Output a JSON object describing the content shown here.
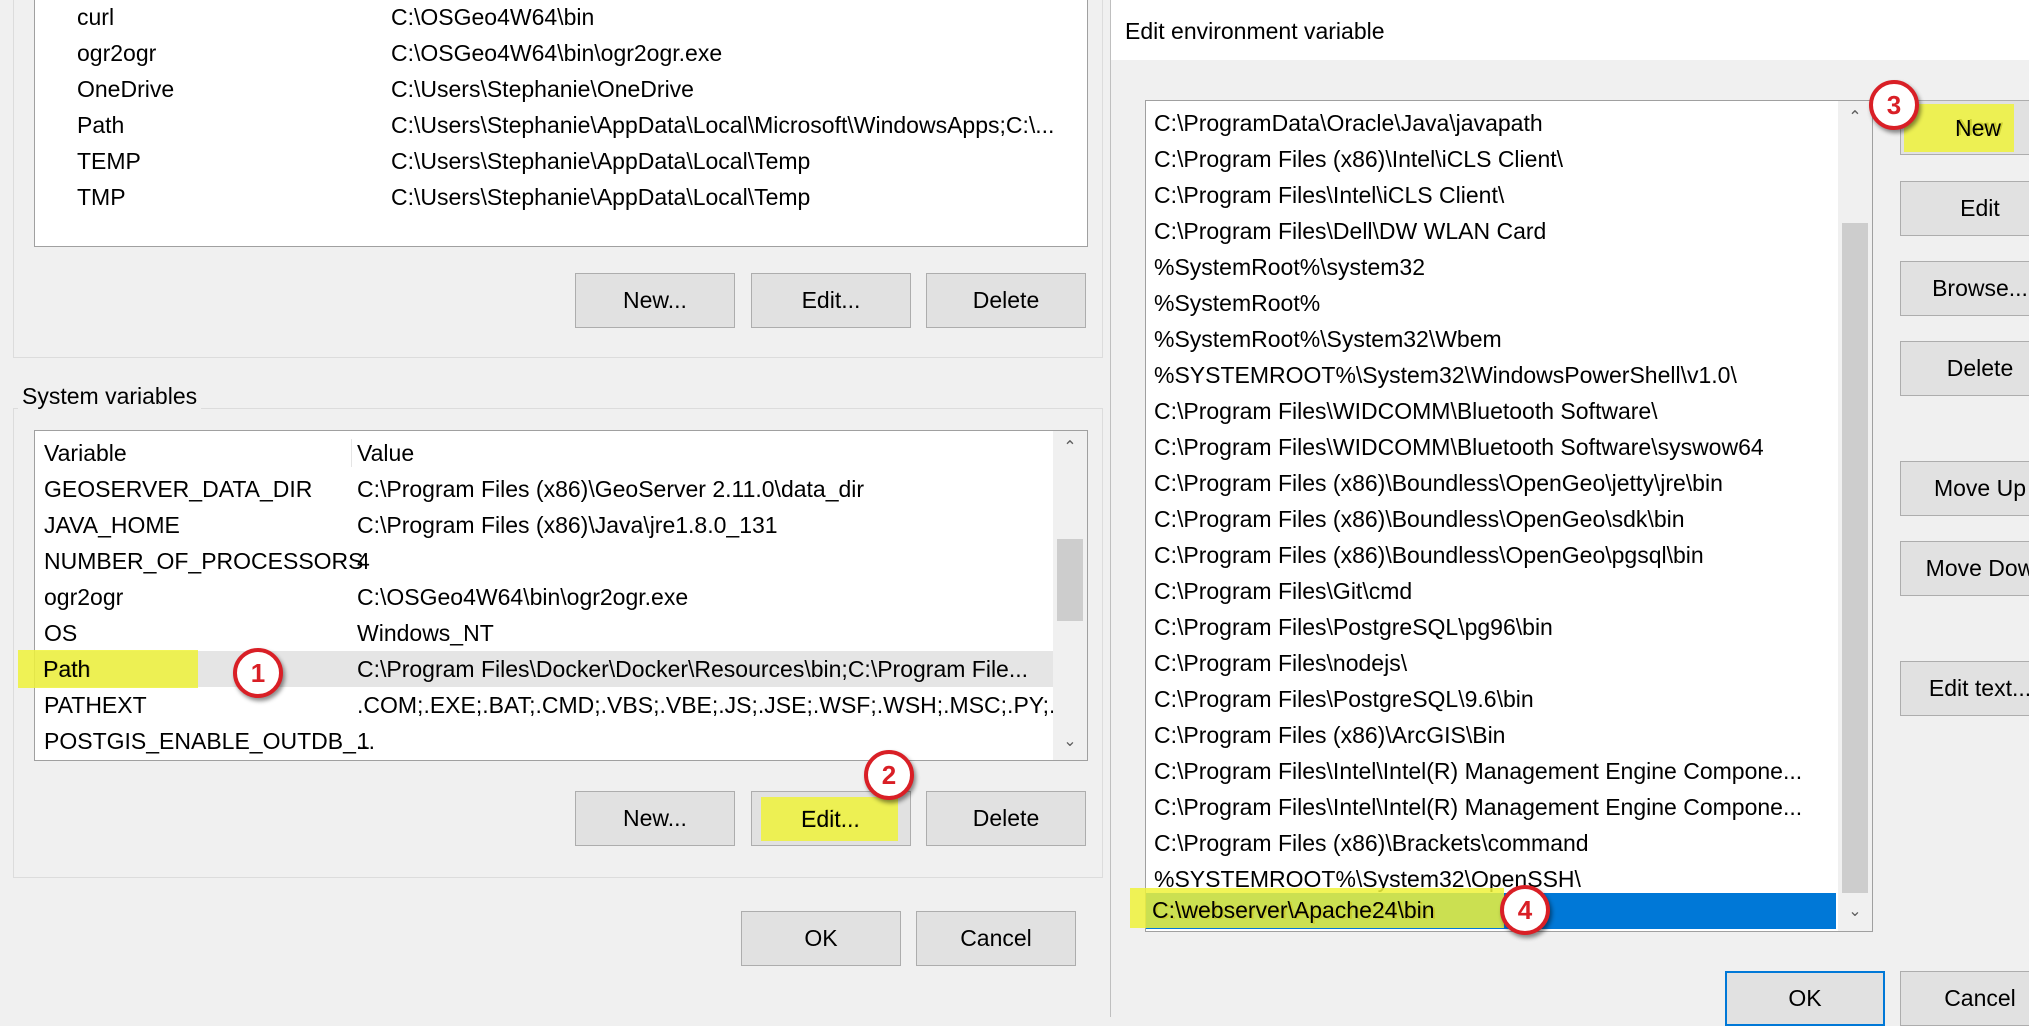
{
  "user_vars": {
    "rows": [
      {
        "name": "curl",
        "value": "C:\\OSGeo4W64\\bin"
      },
      {
        "name": "ogr2ogr",
        "value": "C:\\OSGeo4W64\\bin\\ogr2ogr.exe"
      },
      {
        "name": "OneDrive",
        "value": "C:\\Users\\Stephanie\\OneDrive"
      },
      {
        "name": "Path",
        "value": "C:\\Users\\Stephanie\\AppData\\Local\\Microsoft\\WindowsApps;C:\\..."
      },
      {
        "name": "TEMP",
        "value": "C:\\Users\\Stephanie\\AppData\\Local\\Temp"
      },
      {
        "name": "TMP",
        "value": "C:\\Users\\Stephanie\\AppData\\Local\\Temp"
      }
    ],
    "buttons": {
      "new": "New...",
      "edit": "Edit...",
      "delete": "Delete"
    }
  },
  "system_vars": {
    "label": "System variables",
    "headers": {
      "variable": "Variable",
      "value": "Value"
    },
    "rows": [
      {
        "name": "GEOSERVER_DATA_DIR",
        "value": "C:\\Program Files (x86)\\GeoServer 2.11.0\\data_dir"
      },
      {
        "name": "JAVA_HOME",
        "value": "C:\\Program Files (x86)\\Java\\jre1.8.0_131"
      },
      {
        "name": "NUMBER_OF_PROCESSORS",
        "value": "4"
      },
      {
        "name": "ogr2ogr",
        "value": "C:\\OSGeo4W64\\bin\\ogr2ogr.exe"
      },
      {
        "name": "OS",
        "value": "Windows_NT"
      },
      {
        "name": "Path",
        "value": "C:\\Program Files\\Docker\\Docker\\Resources\\bin;C:\\Program File..."
      },
      {
        "name": "PATHEXT",
        "value": ".COM;.EXE;.BAT;.CMD;.VBS;.VBE;.JS;.JSE;.WSF;.WSH;.MSC;.PY;.PYW"
      },
      {
        "name": "POSTGIS_ENABLE_OUTDB_...",
        "value": "1"
      }
    ],
    "buttons": {
      "new": "New...",
      "edit": "Edit...",
      "delete": "Delete"
    }
  },
  "dialog_buttons": {
    "ok": "OK",
    "cancel": "Cancel"
  },
  "edit_dialog": {
    "title": "Edit environment variable",
    "paths": [
      "C:\\ProgramData\\Oracle\\Java\\javapath",
      "C:\\Program Files (x86)\\Intel\\iCLS Client\\",
      "C:\\Program Files\\Intel\\iCLS Client\\",
      "C:\\Program Files\\Dell\\DW WLAN Card",
      "%SystemRoot%\\system32",
      "%SystemRoot%",
      "%SystemRoot%\\System32\\Wbem",
      "%SYSTEMROOT%\\System32\\WindowsPowerShell\\v1.0\\",
      "C:\\Program Files\\WIDCOMM\\Bluetooth Software\\",
      "C:\\Program Files\\WIDCOMM\\Bluetooth Software\\syswow64",
      "C:\\Program Files (x86)\\Boundless\\OpenGeo\\jetty\\jre\\bin",
      "C:\\Program Files (x86)\\Boundless\\OpenGeo\\sdk\\bin",
      "C:\\Program Files (x86)\\Boundless\\OpenGeo\\pgsql\\bin",
      "C:\\Program Files\\Git\\cmd",
      "C:\\Program Files\\PostgreSQL\\pg96\\bin",
      "C:\\Program Files\\nodejs\\",
      "C:\\Program Files\\PostgreSQL\\9.6\\bin",
      "C:\\Program Files (x86)\\ArcGIS\\Bin",
      "C:\\Program Files\\Intel\\Intel(R) Management Engine Compone...",
      "C:\\Program Files\\Intel\\Intel(R) Management Engine Compone...",
      "C:\\Program Files (x86)\\Brackets\\command",
      "%SYSTEMROOT%\\System32\\OpenSSH\\",
      "C:\\webserver\\Apache24\\bin"
    ],
    "buttons": {
      "new": "New",
      "edit": "Edit",
      "browse": "Browse...",
      "delete": "Delete",
      "move_up": "Move Up",
      "move_down": "Move Dow",
      "edit_text": "Edit text...",
      "ok": "OK",
      "cancel": "Cancel"
    }
  },
  "annotations": [
    "1",
    "2",
    "3",
    "4"
  ],
  "colors": {
    "highlight": "#eef23a",
    "badge": "#d91f26",
    "selection": "#0078d7"
  }
}
